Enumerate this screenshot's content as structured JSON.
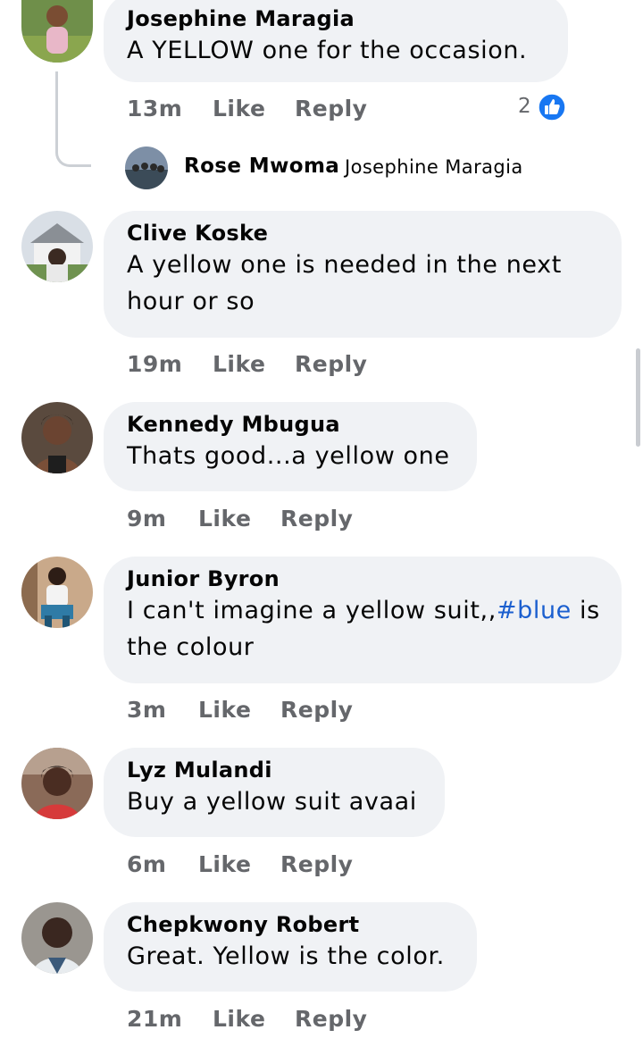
{
  "comments": [
    {
      "name": "Josephine Maragia",
      "text_lines": [
        "A YELLOW one for the occasion."
      ],
      "time": "13m",
      "like": "Like",
      "reply": "Reply"
    },
    {
      "name": "Clive Koske",
      "text_lines": [
        "A yellow one is needed in the next",
        "hour or so"
      ],
      "time": "19m",
      "like": "Like",
      "reply": "Reply"
    },
    {
      "name": "Kennedy Mbugua",
      "text_lines": [
        "Thats good...a yellow one"
      ],
      "time": "9m",
      "like": "Like",
      "reply": "Reply"
    },
    {
      "name": "Junior Byron",
      "text_lines": [
        "I can't imagine a yellow suit,,",
        "the colour"
      ],
      "hashtag": "#blue",
      "after_hashtag": " is",
      "time": "3m",
      "like": "Like",
      "reply": "Reply"
    },
    {
      "name": "Lyz Mulandi",
      "text_lines": [
        "Buy a yellow suit avaai"
      ],
      "time": "6m",
      "like": "Like",
      "reply": "Reply"
    },
    {
      "name": "Chepkwony Robert",
      "text_lines": [
        "Great. Yellow is the color."
      ],
      "time": "21m",
      "like": "Like",
      "reply": "Reply"
    }
  ],
  "reactions": {
    "count": "2",
    "icon": "thumbs-up-icon",
    "color": "#1877f2"
  },
  "reply_preview": {
    "name": "Rose Mwoma",
    "tagged": "Josephine Maragia"
  }
}
